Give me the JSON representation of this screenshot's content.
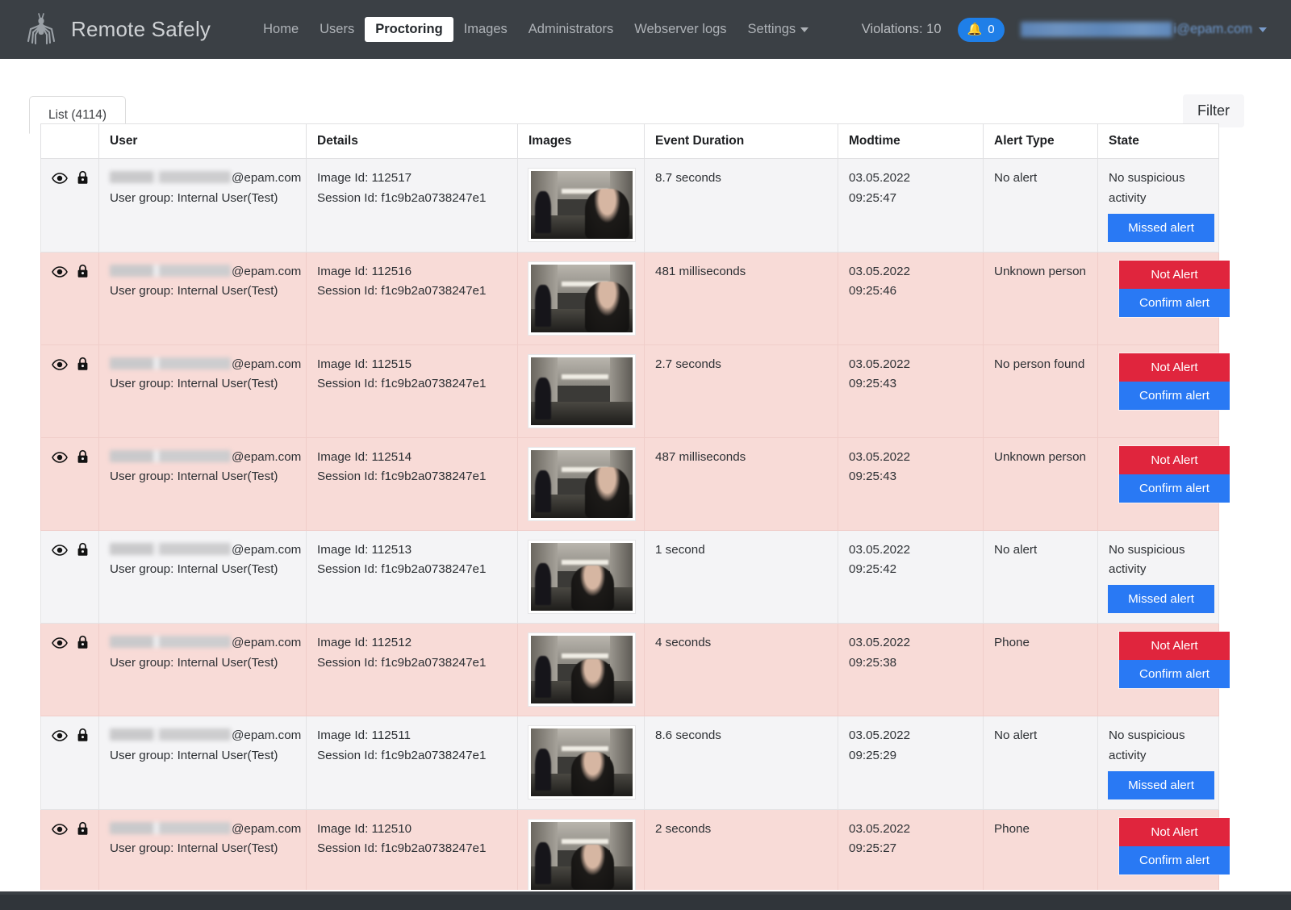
{
  "navbar": {
    "brand": "Remote Safely",
    "logo_icon": "spider-logo-icon",
    "links": [
      {
        "label": "Home",
        "active": false
      },
      {
        "label": "Users",
        "active": false
      },
      {
        "label": "Proctoring",
        "active": true
      },
      {
        "label": "Images",
        "active": false
      },
      {
        "label": "Administrators",
        "active": false
      },
      {
        "label": "Webserver logs",
        "active": false
      },
      {
        "label": "Settings",
        "active": false,
        "caret": true
      }
    ],
    "violations_label": "Violations: 10",
    "bell_icon": "bell-icon",
    "bell_count": "0",
    "user_email_domain": "i@epam.com",
    "user_caret_icon": "chevron-down-icon",
    "accent_blue": "#1f7fe8",
    "bar_color": "#3b4045"
  },
  "toolbar": {
    "tab_label": "List (4114)",
    "filter_label": "Filter"
  },
  "table": {
    "columns": [
      "",
      "User",
      "Details",
      "Images",
      "Event Duration",
      "Modtime",
      "Alert Type",
      "State"
    ],
    "row_icons": {
      "view": "eye-icon",
      "lock": "lock-icon"
    },
    "labels": {
      "email_domain": "@epam.com",
      "user_group": "User group: Internal User(Test)",
      "image_id_prefix": "Image Id: ",
      "session_id_prefix": "Session Id: "
    },
    "buttons": {
      "missed_alert": "Missed alert",
      "not_alert": "Not Alert",
      "confirm_alert": "Confirm alert"
    },
    "state_text": {
      "no_suspicious": "No suspicious activity"
    },
    "colors": {
      "row_light": "#f4f4f6",
      "row_alert": "#f8dbd7",
      "btn_blue": "#2979f4",
      "btn_red": "#e0253d"
    },
    "rows": [
      {
        "image_id": "112517",
        "session_id": "f1c9b2a0738247e1",
        "duration": "8.7 seconds",
        "mod_date": "03.05.2022",
        "mod_time": "09:25:47",
        "alert_type": "No alert",
        "state": "no_suspicious",
        "highlight": false,
        "thumb": "hallway-face-right"
      },
      {
        "image_id": "112516",
        "session_id": "f1c9b2a0738247e1",
        "duration": "481 milliseconds",
        "mod_date": "03.05.2022",
        "mod_time": "09:25:46",
        "alert_type": "Unknown person",
        "state": "actions",
        "highlight": true,
        "thumb": "hallway-face-right"
      },
      {
        "image_id": "112515",
        "session_id": "f1c9b2a0738247e1",
        "duration": "2.7 seconds",
        "mod_date": "03.05.2022",
        "mod_time": "09:25:43",
        "alert_type": "No person found",
        "state": "actions",
        "highlight": true,
        "thumb": "hallway-empty"
      },
      {
        "image_id": "112514",
        "session_id": "f1c9b2a0738247e1",
        "duration": "487 milliseconds",
        "mod_date": "03.05.2022",
        "mod_time": "09:25:43",
        "alert_type": "Unknown person",
        "state": "actions",
        "highlight": true,
        "thumb": "hallway-face-right"
      },
      {
        "image_id": "112513",
        "session_id": "f1c9b2a0738247e1",
        "duration": "1 second",
        "mod_date": "03.05.2022",
        "mod_time": "09:25:42",
        "alert_type": "No alert",
        "state": "no_suspicious",
        "highlight": false,
        "thumb": "hallway-face-center"
      },
      {
        "image_id": "112512",
        "session_id": "f1c9b2a0738247e1",
        "duration": "4 seconds",
        "mod_date": "03.05.2022",
        "mod_time": "09:25:38",
        "alert_type": "Phone",
        "state": "actions",
        "highlight": true,
        "thumb": "hallway-face-center"
      },
      {
        "image_id": "112511",
        "session_id": "f1c9b2a0738247e1",
        "duration": "8.6 seconds",
        "mod_date": "03.05.2022",
        "mod_time": "09:25:29",
        "alert_type": "No alert",
        "state": "no_suspicious",
        "highlight": false,
        "thumb": "hallway-face-center"
      },
      {
        "image_id": "112510",
        "session_id": "f1c9b2a0738247e1",
        "duration": "2 seconds",
        "mod_date": "03.05.2022",
        "mod_time": "09:25:27",
        "alert_type": "Phone",
        "state": "actions",
        "highlight": true,
        "thumb": "hallway-face-center"
      }
    ]
  }
}
